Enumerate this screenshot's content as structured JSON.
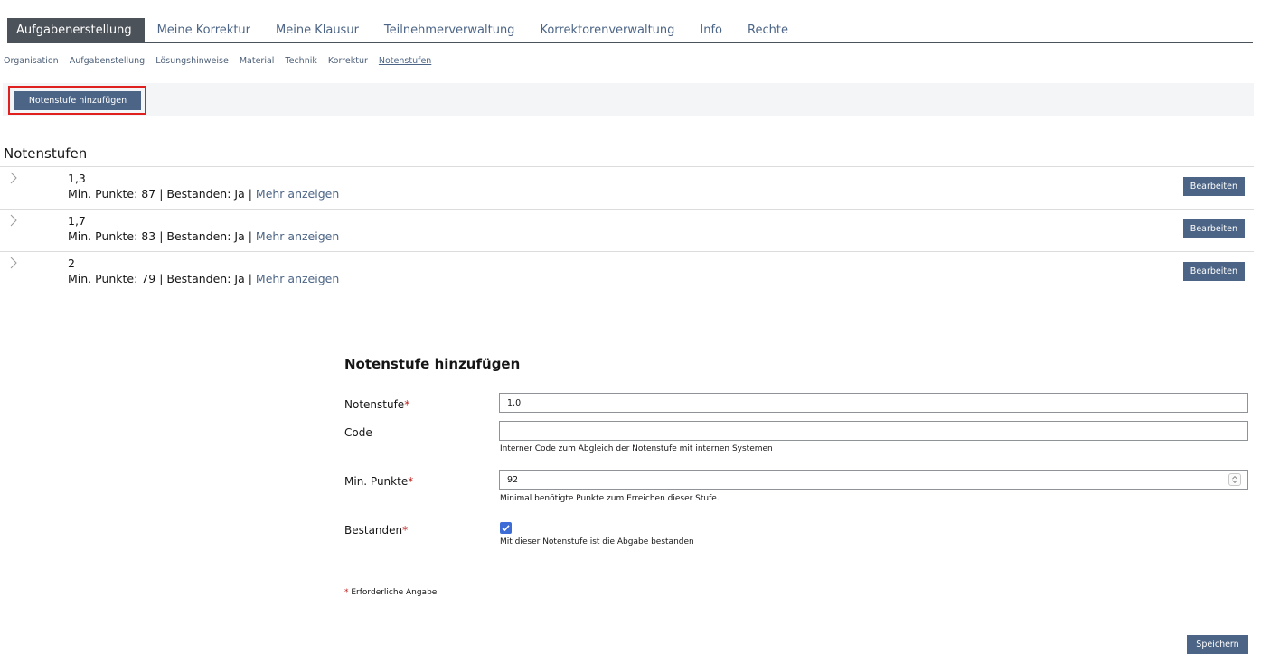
{
  "main_tabs": [
    {
      "label": "Aufgabenerstellung",
      "active": true
    },
    {
      "label": "Meine Korrektur",
      "active": false
    },
    {
      "label": "Meine Klausur",
      "active": false
    },
    {
      "label": "Teilnehmerverwaltung",
      "active": false
    },
    {
      "label": "Korrektorenverwaltung",
      "active": false
    },
    {
      "label": "Info",
      "active": false
    },
    {
      "label": "Rechte",
      "active": false
    }
  ],
  "sub_tabs": [
    {
      "label": "Organisation",
      "active": false
    },
    {
      "label": "Aufgabenstellung",
      "active": false
    },
    {
      "label": "Lösungshinweise",
      "active": false
    },
    {
      "label": "Material",
      "active": false
    },
    {
      "label": "Technik",
      "active": false
    },
    {
      "label": "Korrektur",
      "active": false
    },
    {
      "label": "Notenstufen",
      "active": true
    }
  ],
  "toolbar": {
    "add_label": "Notenstufe hinzufügen"
  },
  "list": {
    "title": "Notenstufen",
    "items": [
      {
        "grade": "1,3",
        "min_points_label": "Min. Punkte: 87",
        "passed_label": "Bestanden: Ja",
        "more": "Mehr anzeigen",
        "edit": "Bearbeiten"
      },
      {
        "grade": "1,7",
        "min_points_label": "Min. Punkte: 83",
        "passed_label": "Bestanden: Ja",
        "more": "Mehr anzeigen",
        "edit": "Bearbeiten"
      },
      {
        "grade": "2",
        "min_points_label": "Min. Punkte: 79",
        "passed_label": "Bestanden: Ja",
        "more": "Mehr anzeigen",
        "edit": "Bearbeiten"
      }
    ]
  },
  "form": {
    "title": "Notenstufe hinzufügen",
    "grade_label": "Notenstufe",
    "grade_value": "1,0",
    "code_label": "Code",
    "code_value": "",
    "code_help": "Interner Code zum Abgleich der Notenstufe mit internen Systemen",
    "points_label": "Min. Punkte",
    "points_value": "92",
    "points_help": "Minimal benötigte Punkte zum Erreichen dieser Stufe.",
    "passed_label": "Bestanden",
    "passed_checked": true,
    "passed_help": "Mit dieser Notenstufe ist die Abgabe bestanden",
    "required_marker": "*",
    "required_note": "Erforderliche Angabe",
    "save_label": "Speichern"
  },
  "colors": {
    "accent": "#4c6586",
    "active_tab": "#4c5259",
    "required": "#c01e1e",
    "highlight": "#e01f1f",
    "checkbox": "#3d6cd6"
  },
  "icons": {
    "chevron": "chevron-right-icon",
    "checkmark": "checkmark-icon",
    "stepper": "stepper-icon"
  }
}
